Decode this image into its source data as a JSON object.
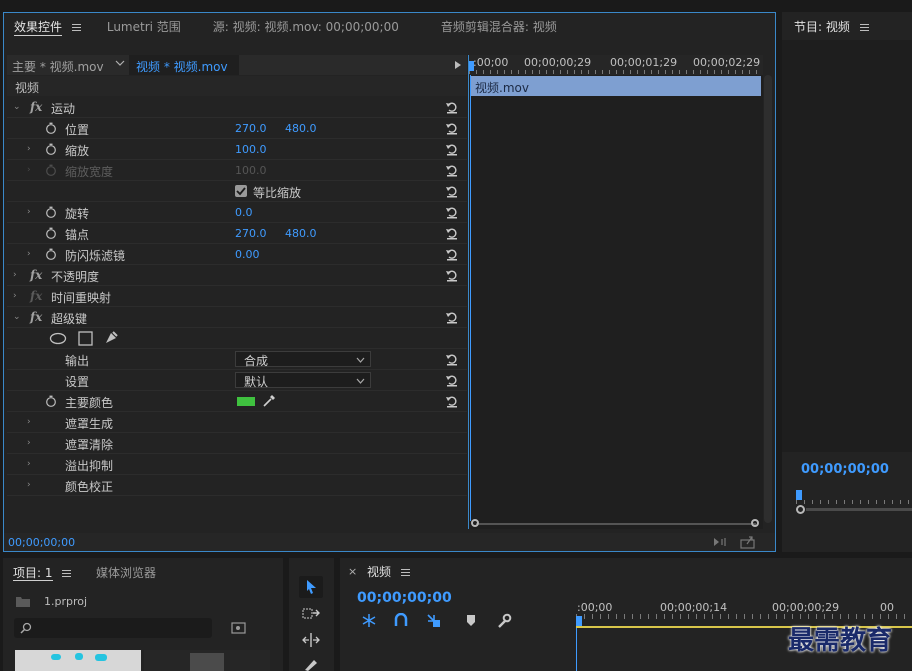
{
  "effect_controls": {
    "tabs": [
      {
        "label": "效果控件",
        "active": true
      },
      {
        "label": "Lumetri 范围",
        "active": false
      },
      {
        "label": "源: 视频: 视频.mov: 00;00;00;00",
        "active": false
      },
      {
        "label": "音频剪辑混合器: 视频",
        "active": false
      }
    ],
    "master_clip": "主要 * 视频.mov",
    "sequence_clip": "视频 * 视频.mov",
    "section_label": "视频",
    "rows": [
      {
        "kind": "fx",
        "label": "运动"
      },
      {
        "kind": "param",
        "label": "位置",
        "v1": "270.0",
        "v2": "480.0"
      },
      {
        "kind": "param",
        "label": "缩放",
        "v1": "100.0"
      },
      {
        "kind": "param",
        "label": "缩放宽度",
        "v1": "100.0",
        "disabled": true
      },
      {
        "kind": "check",
        "label": "等比缩放",
        "checked": true
      },
      {
        "kind": "param",
        "label": "旋转",
        "v1": "0.0"
      },
      {
        "kind": "param",
        "label": "锚点",
        "v1": "270.0",
        "v2": "480.0"
      },
      {
        "kind": "param",
        "label": "防闪烁滤镜",
        "v1": "0.00"
      },
      {
        "kind": "fx",
        "label": "不透明度"
      },
      {
        "kind": "fx",
        "label": "时间重映射"
      },
      {
        "kind": "fx",
        "label": "超级键"
      },
      {
        "kind": "param",
        "label": "输出",
        "dropdown": "合成"
      },
      {
        "kind": "param",
        "label": "设置",
        "dropdown": "默认"
      },
      {
        "kind": "param",
        "label": "主要颜色",
        "color": "#3fc13f"
      },
      {
        "kind": "group",
        "label": "遮罩生成"
      },
      {
        "kind": "group",
        "label": "遮罩清除"
      },
      {
        "kind": "group",
        "label": "溢出抑制"
      },
      {
        "kind": "group",
        "label": "颜色校正"
      }
    ],
    "timeline": {
      "ruler": [
        ":00;00",
        "00;00;00;29",
        "00;00;01;29",
        "00;00;02;29"
      ],
      "clip_label": "视频.mov"
    },
    "timecode": "00;00;00;00"
  },
  "program_monitor": {
    "title": "节目: 视频",
    "timecode": "00;00;00;00"
  },
  "project": {
    "tabs": [
      {
        "label": "项目: 1",
        "active": true
      },
      {
        "label": "媒体浏览器",
        "active": false
      }
    ],
    "file_name": "1.prproj",
    "search_placeholder": ""
  },
  "sequence": {
    "close": "×",
    "title": "视频",
    "timecode": "00;00;00;00",
    "ruler": [
      ":00;00",
      "00;00;00;14",
      "00;00;00;29",
      "00"
    ]
  },
  "watermark": "最需教育",
  "colors": {
    "accent_blue": "#3f9bff",
    "clip_blue": "#7e9fd1",
    "key_green": "#3fc13f",
    "panel_border": "#3a88c9"
  }
}
